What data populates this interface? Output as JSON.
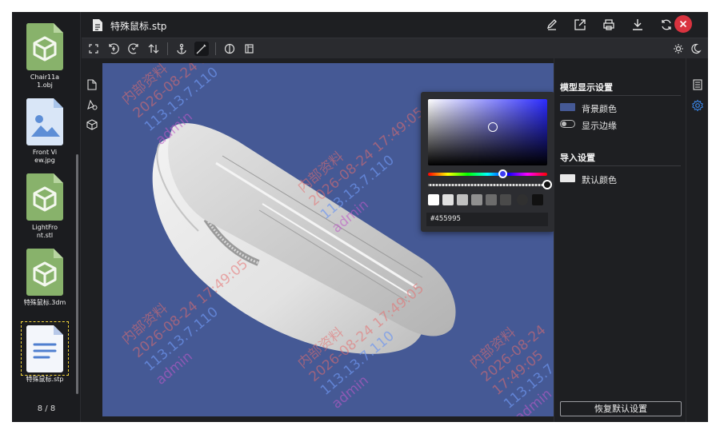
{
  "file_list": {
    "items": [
      {
        "name": "Chair11a1.obj",
        "caption": "Chair11a\n1.obj",
        "kind": "model"
      },
      {
        "name": "Front View.jpg",
        "caption": "Front Vi\new.jpg",
        "kind": "image"
      },
      {
        "name": "LightFront.stl",
        "caption": "LightFro\nnt.stl",
        "kind": "model"
      },
      {
        "name": "特殊鼠标.3dm",
        "caption": "特殊鼠标.3dm",
        "kind": "model"
      },
      {
        "name": "特殊鼠标.stp",
        "caption": "特殊鼠标.stp",
        "kind": "document",
        "active": true
      }
    ],
    "counter": "8 / 8"
  },
  "header": {
    "title": "特殊鼠标.stp",
    "buttons": [
      "edit-icon",
      "open-external-icon",
      "print-icon",
      "download-icon",
      "refresh-icon",
      "close-icon"
    ]
  },
  "toolbar": {
    "tools": [
      "fit-view-icon",
      "rotate-x-icon",
      "rotate-y-icon",
      "flip-icon",
      "anchor-icon",
      "measure-icon",
      "section-icon",
      "explode-icon",
      "light-icon",
      "dark-mode-icon"
    ]
  },
  "viewport": {
    "background_color": "#455995",
    "watermark": {
      "lines": [
        "内部资料",
        "2026-08-24 17:49:05",
        "113.13.7.110",
        "admin"
      ]
    }
  },
  "color_picker": {
    "hex_value": "#455995",
    "swatches": [
      "#ffffff",
      "#e0e0e0",
      "#c0c0c0",
      "#909090",
      "#6c6c6c",
      "#4a4a4a",
      "#303030",
      "#111111"
    ]
  },
  "settings": {
    "model_section": {
      "title": "模型显示设置",
      "background_label": "背景颜色",
      "background_color": "#455995",
      "edges_label": "显示边缘",
      "edges_on": false
    },
    "import_section": {
      "title": "导入设置",
      "default_color_label": "默认颜色",
      "default_color": "#e8e8e8"
    },
    "reset_label": "恢复默认设置"
  }
}
